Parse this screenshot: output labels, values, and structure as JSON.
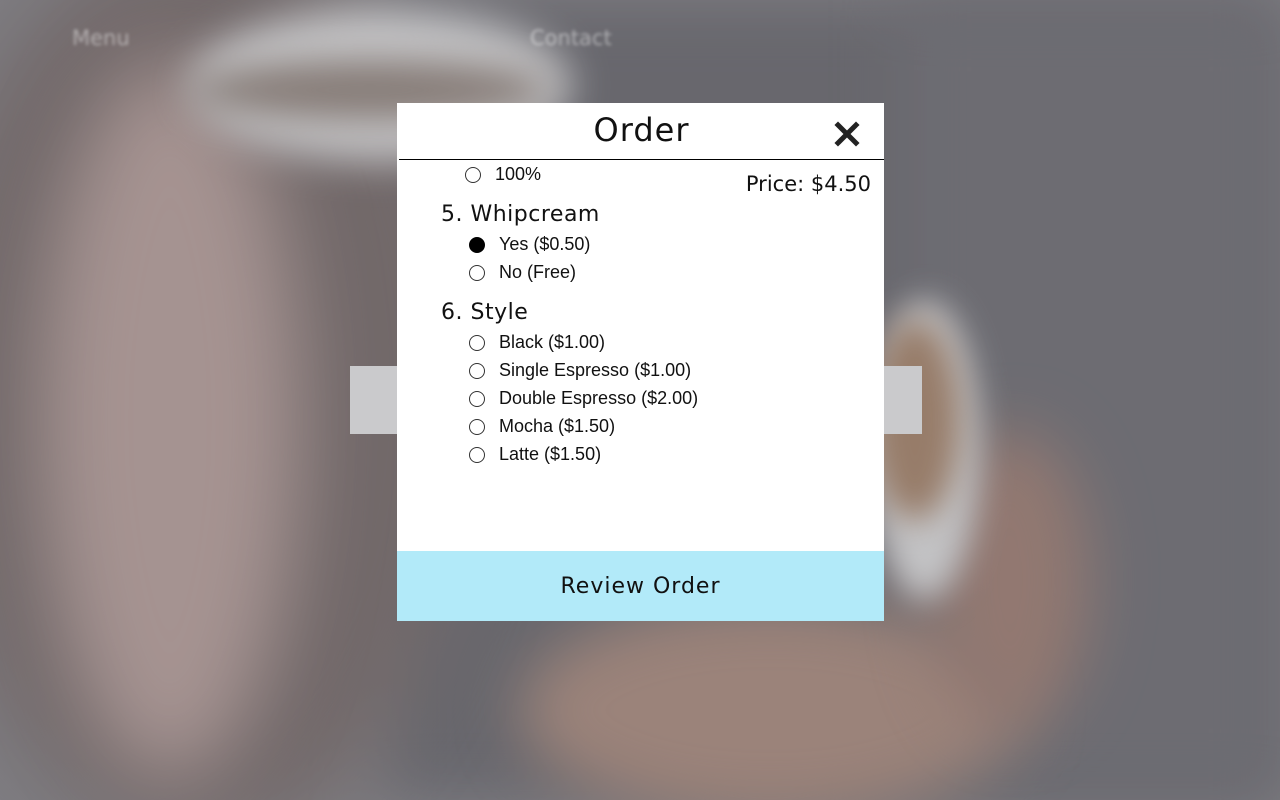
{
  "nav": {
    "left_label": "Menu",
    "right_label": "Contact"
  },
  "modal": {
    "title": "Order",
    "price_text": "Price: $4.50",
    "partial_option": "100%",
    "sections": [
      {
        "title": "5. Whipcream",
        "options": [
          {
            "label": "Yes ($0.50)",
            "checked": true
          },
          {
            "label": "No (Free)",
            "checked": false
          }
        ]
      },
      {
        "title": "6. Style",
        "options": [
          {
            "label": "Black ($1.00)",
            "checked": false
          },
          {
            "label": "Single Espresso ($1.00)",
            "checked": false
          },
          {
            "label": "Double Espresso ($2.00)",
            "checked": false
          },
          {
            "label": "Mocha ($1.50)",
            "checked": false
          },
          {
            "label": "Latte ($1.50)",
            "checked": false
          }
        ]
      }
    ],
    "review_button_label": "Review Order",
    "close_icon": "close-icon"
  },
  "colors": {
    "review_button_bg": "#b2eaf9",
    "modal_bg": "#ffffff"
  }
}
